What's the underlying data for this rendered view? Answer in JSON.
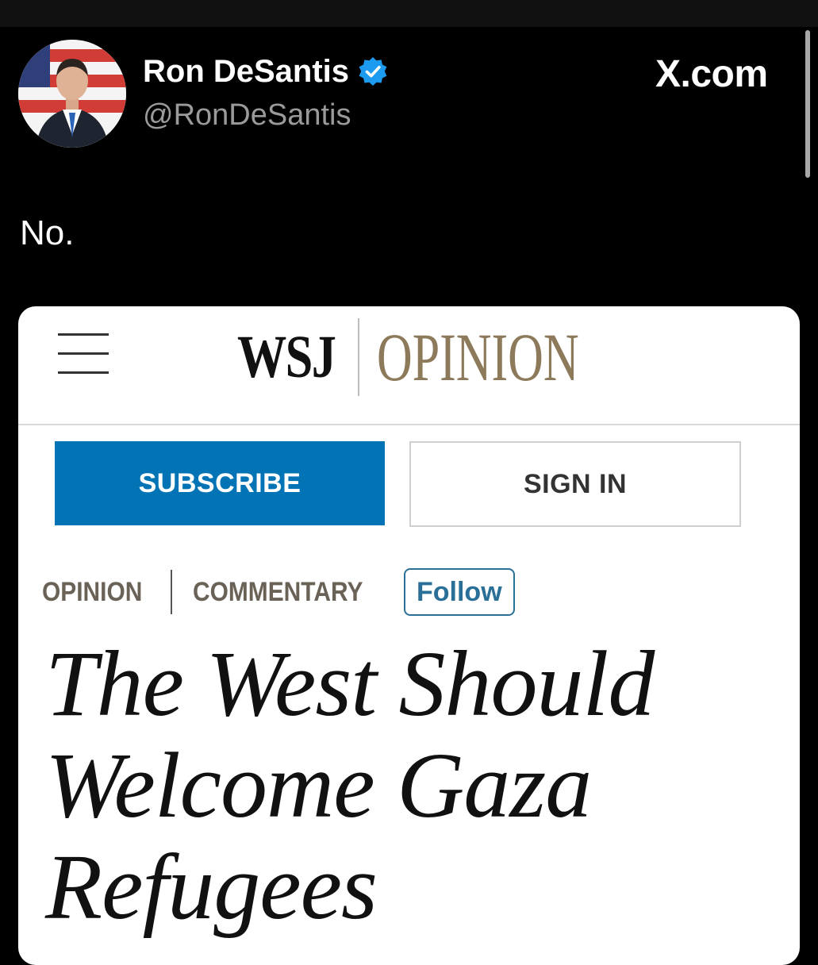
{
  "post": {
    "author_name": "Ron DeSantis",
    "handle": "@RonDeSantis",
    "site": "X.com",
    "text": "No."
  },
  "colors": {
    "verified_badge": "#1d9bf0",
    "wsj_opinion": "#8c7a5b",
    "subscribe_bg": "#0274b6",
    "follow_border": "#2a6f97"
  },
  "card": {
    "logo_mark": "WSJ",
    "logo_section": "OPINION",
    "subscribe_label": "SUBSCRIBE",
    "signin_label": "SIGN IN",
    "breadcrumb": {
      "section": "OPINION",
      "subsection": "COMMENTARY",
      "follow_label": "Follow"
    },
    "headline_lines": [
      "The West Should",
      "Welcome Gaza",
      "Refugees"
    ]
  },
  "icons": [
    "verified-badge-icon",
    "hamburger-menu-icon"
  ]
}
